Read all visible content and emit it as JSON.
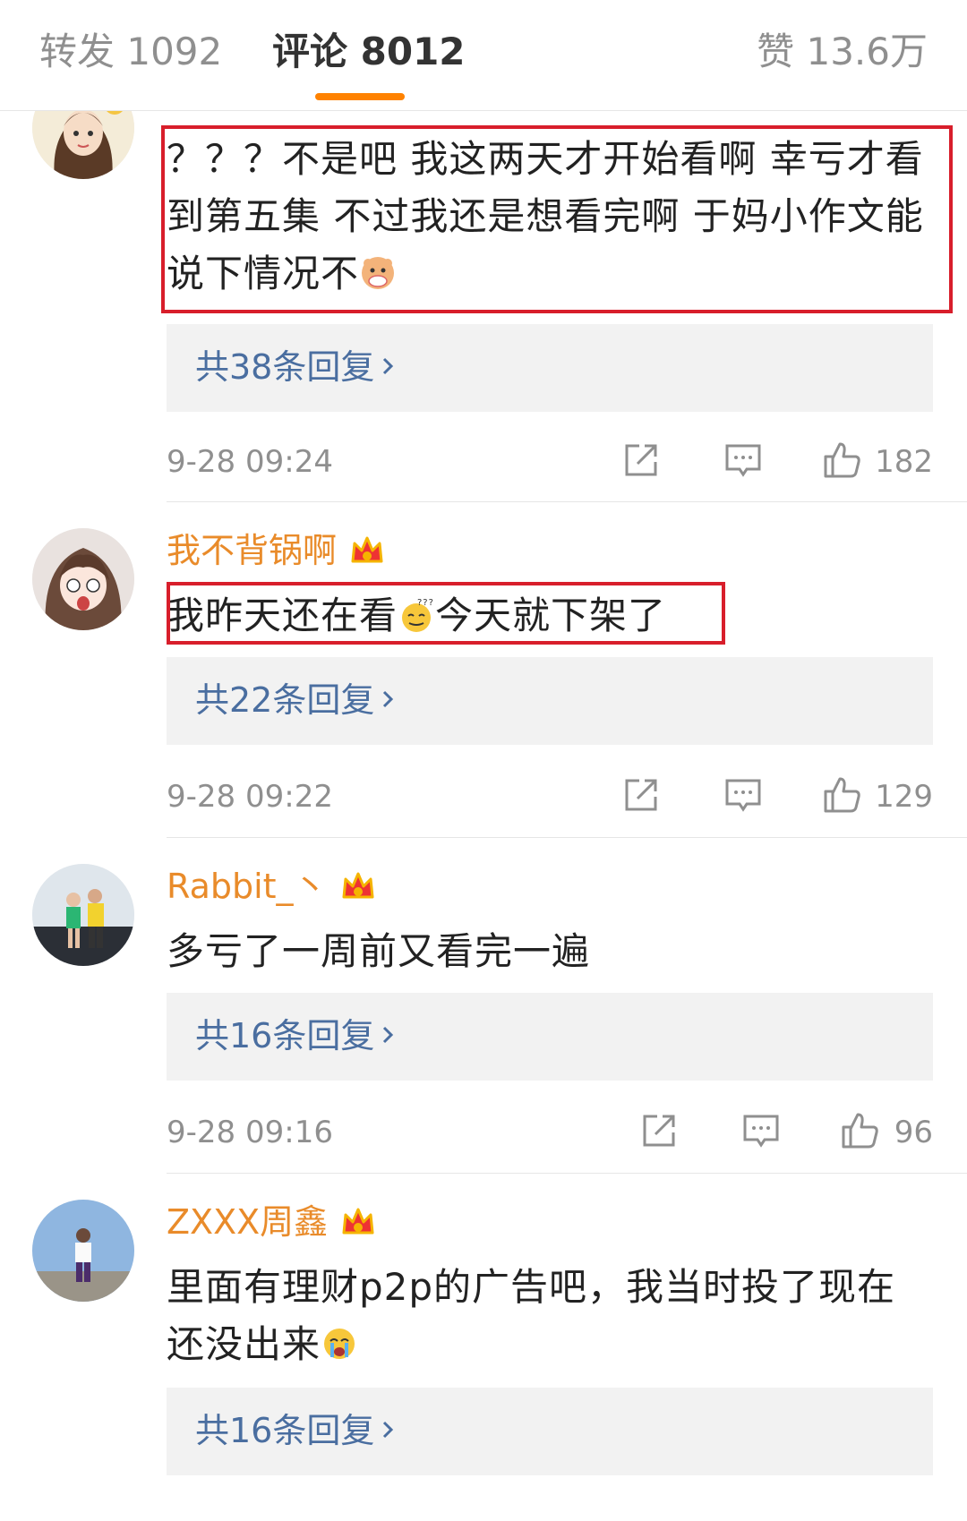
{
  "tabs": {
    "reposts": "转发 1092",
    "comments": "评论 8012",
    "likes": "赞 13.6万"
  },
  "comments": [
    {
      "username": "",
      "text": "？？？不是吧 我这两天才开始看啊 幸亏才看到第五集 不过我还是想看完啊 于妈小作文能说下情况不",
      "emoji": "doge-hug-icon",
      "replies": "共38条回复",
      "time": "9-28 09:24",
      "likes": "182"
    },
    {
      "username": "我不背锅啊",
      "text_before": "我昨天还在看",
      "text_after": "今天就下架了",
      "emoji": "dizzy-face-icon",
      "replies": "共22条回复",
      "time": "9-28 09:22",
      "likes": "129"
    },
    {
      "username": "Rabbit_丶",
      "text": "多亏了一周前又看完一遍",
      "replies": "共16条回复",
      "time": "9-28 09:16",
      "likes": "96"
    },
    {
      "username": "ZXXX周鑫",
      "text": "里面有理财p2p的广告吧，我当时投了现在还没出来",
      "emoji": "crying-face-icon",
      "replies": "共16条回复"
    }
  ],
  "colors": {
    "username": "#e98b2a",
    "replies_link": "#4a6ea0",
    "tab_indicator": "#ff8200",
    "highlight_box": "#d81e2b"
  }
}
